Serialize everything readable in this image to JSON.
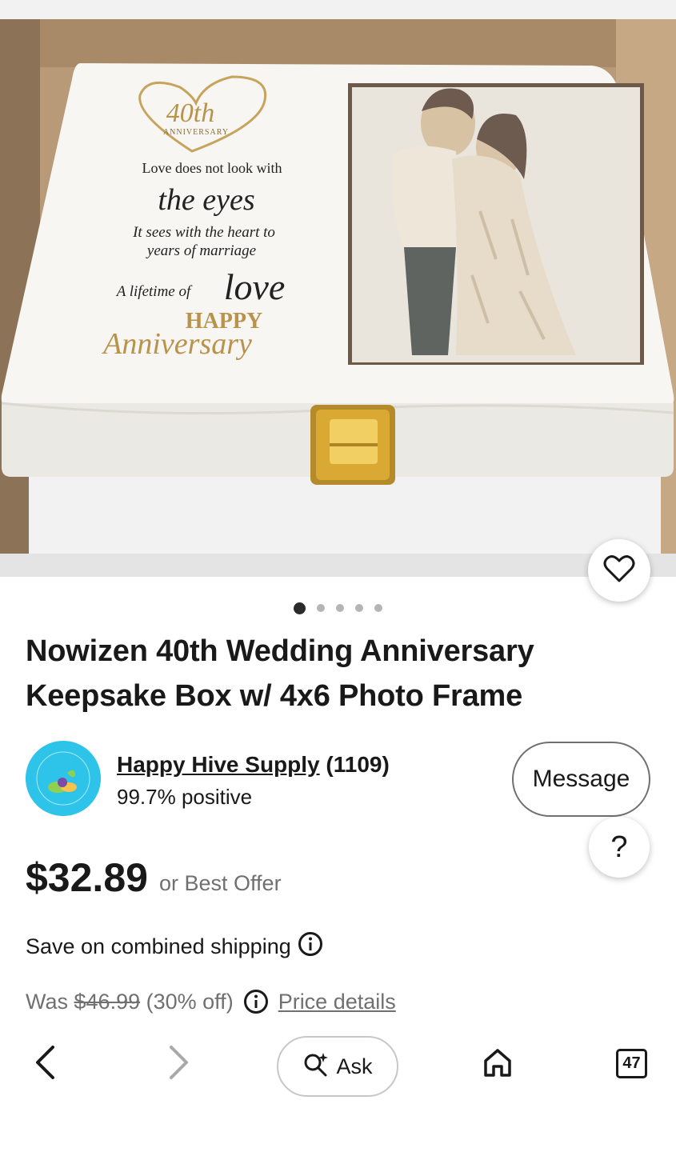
{
  "product": {
    "title": "Nowizen 40th Wedding Anniversary Keepsake Box w/ 4x6 Photo Frame",
    "image_text": {
      "badge_number": "40th",
      "badge_sub": "ANNIVERSARY",
      "line1": "Love does not look with",
      "line2": "the eyes",
      "line3": "It sees with the heart to",
      "line4": "years of marriage",
      "line5_prefix": "A lifetime of",
      "line5_word": "love",
      "line6": "HAPPY",
      "line7": "Anniversary"
    },
    "image_count": 5,
    "active_image": 1
  },
  "seller": {
    "name": "Happy Hive Supply",
    "feedback_count": "(1109)",
    "positive": "99.7% positive",
    "avatar_text": "HAPPY HIVE SUPPLY",
    "avatar_color": "#2ec4ea"
  },
  "actions": {
    "message_label": "Message",
    "help_label": "?"
  },
  "pricing": {
    "price": "$32.89",
    "best_offer": "or Best Offer",
    "shipping": "Save on combined shipping",
    "was_label": "Was",
    "was_price": "$46.99",
    "discount": "(30% off)",
    "price_details": "Price details"
  },
  "nav": {
    "ask_label": "Ask",
    "tabs_count": "47"
  },
  "icons": {
    "favorite": "heart-icon",
    "info": "info-icon",
    "back": "chevron-left-icon",
    "forward": "chevron-right-icon",
    "ask": "sparkle-search-icon",
    "home": "home-icon",
    "tabs": "tabs-icon"
  }
}
